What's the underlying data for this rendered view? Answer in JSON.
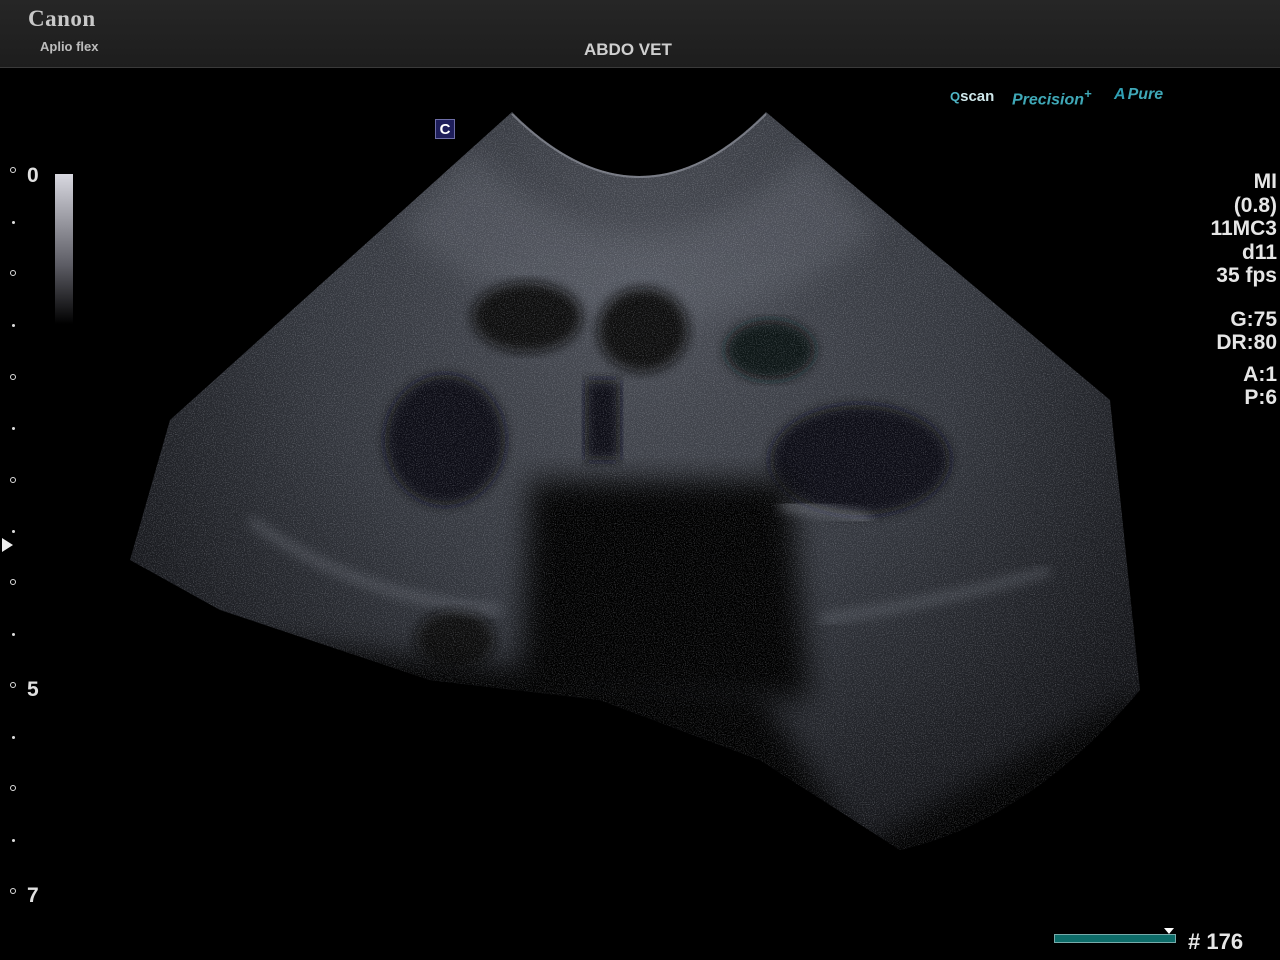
{
  "header": {
    "brand": "Canon",
    "model": "Aplio flex",
    "preset": "ABDO VET"
  },
  "features": {
    "qscan_q": "Q",
    "qscan_rest": "scan",
    "precision": "Precision",
    "precision_plus": "+",
    "apure_a": "A",
    "apure_rest": "Pure"
  },
  "marker": {
    "label": "C"
  },
  "depth_scale": {
    "label_top": "0",
    "label_mid": "5",
    "label_bottom": "7"
  },
  "parameters": {
    "mi": "MI",
    "mi_value": "(0.8)",
    "probe": "11MC3",
    "depth": "d11",
    "frame_rate": "35 fps",
    "gain": "G:75",
    "dynamic_range": "DR:80",
    "a_value": "A:1",
    "p_value": "P:6"
  },
  "cine": {
    "frame": "# 176"
  }
}
